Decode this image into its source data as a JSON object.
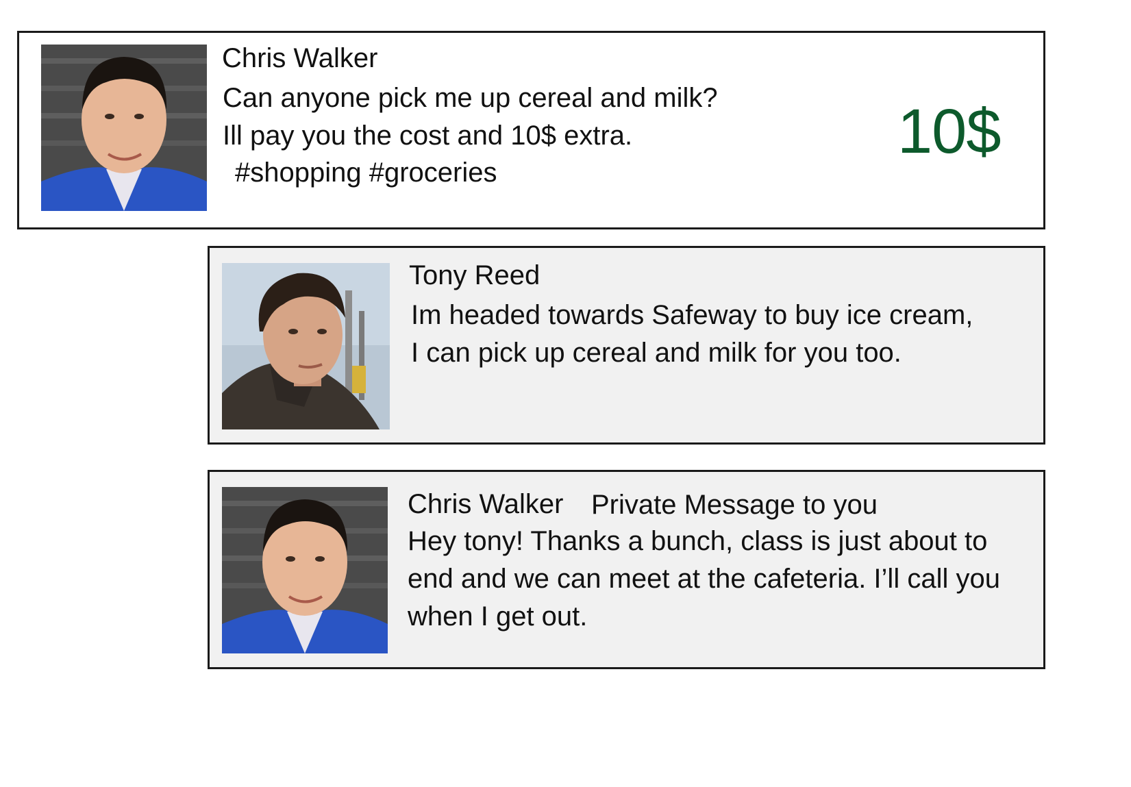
{
  "feed": {
    "post": {
      "author": "Chris Walker",
      "lines": [
        "Can anyone pick me up cereal and milk?",
        "Ill pay you the cost and 10$ extra.",
        "#shopping #groceries"
      ],
      "price": "10$",
      "price_color": "#0d5a2c"
    },
    "reply": {
      "author": "Tony Reed",
      "lines": [
        "Im headed towards Safeway to buy ice cream,",
        "I can pick up cereal and milk for you too."
      ]
    },
    "private_message": {
      "author": "Chris Walker",
      "label": "Private Message to you",
      "lines": [
        "Hey tony! Thanks a bunch, class is just about to",
        "end and we can meet at the cafeteria. I’ll call you",
        "when I get out."
      ]
    }
  },
  "colors": {
    "card_border": "#1a1a1a",
    "post_background": "#ffffff",
    "reply_background": "#f1f1f1"
  }
}
